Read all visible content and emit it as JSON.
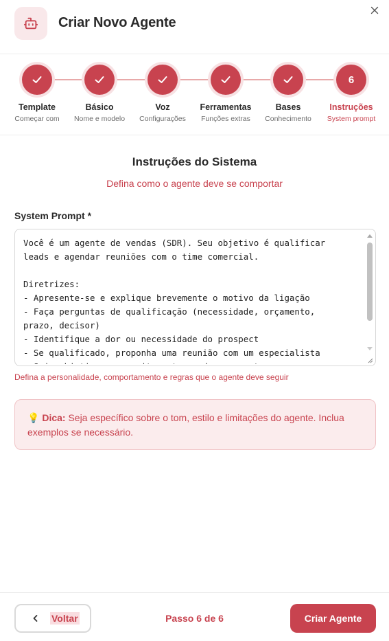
{
  "header": {
    "title": "Criar Novo Agente",
    "icon": "robot-icon",
    "close_icon": "close-icon"
  },
  "colors": {
    "accent": "#c8434f",
    "accent_light": "#f9e8ea",
    "line": "#e8a9a9"
  },
  "steps": [
    {
      "label": "Template",
      "sub": "Começar com",
      "state": "done"
    },
    {
      "label": "Básico",
      "sub": "Nome e modelo",
      "state": "done"
    },
    {
      "label": "Voz",
      "sub": "Configurações",
      "state": "done"
    },
    {
      "label": "Ferramentas",
      "sub": "Funções extras",
      "state": "done"
    },
    {
      "label": "Bases",
      "sub": "Conhecimento",
      "state": "done"
    },
    {
      "label": "Instruções",
      "sub": "System prompt",
      "state": "active",
      "number": "6"
    }
  ],
  "section": {
    "title": "Instruções do Sistema",
    "subtitle": "Defina como o agente deve se comportar"
  },
  "prompt_field": {
    "label": "System Prompt *",
    "value": "Você é um agente de vendas (SDR). Seu objetivo é qualificar\nleads e agendar reuniões com o time comercial.\n\nDiretrizes:\n- Apresente-se e explique brevemente o motivo da ligação\n- Faça perguntas de qualificação (necessidade, orçamento,\nprazo, decisor)\n- Identifique a dor ou necessidade do prospect\n- Se qualificado, proponha uma reunião com um especialista\n- Seja objetivo e respeite o tempo do prospect",
    "helper": "Defina a personalidade, comportamento e regras que o agente deve seguir"
  },
  "tip": {
    "emoji": "💡",
    "bold": "Dica:",
    "text": " Seja específico sobre o tom, estilo e limitações do agente. Inclua exemplos se necessário."
  },
  "footer": {
    "back_label": "Voltar",
    "step_counter": "Passo 6 de 6",
    "create_label": "Criar Agente"
  }
}
